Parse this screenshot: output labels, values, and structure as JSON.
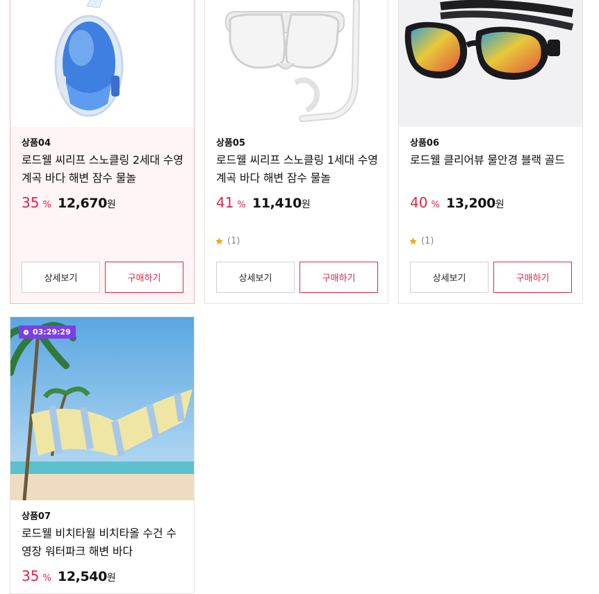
{
  "products": [
    {
      "code": "상품04",
      "name": "로드웰 씨리프 스노클링 2세대 수영 계곡 바다 해변 잠수 물놀",
      "rate": "35",
      "pct": "%",
      "price": "12,670",
      "won": "원",
      "review": "",
      "detail_label": "상세보기",
      "buy_label": "구매하기",
      "image_icon": "full-face-snorkel-mask-icon"
    },
    {
      "code": "상품05",
      "name": "로드웰 씨리프 스노클링 1세대 수영 계곡 바다 해변 잠수 물놀",
      "rate": "41",
      "pct": "%",
      "price": "11,410",
      "won": "원",
      "review": "(1)",
      "detail_label": "상세보기",
      "buy_label": "구매하기",
      "image_icon": "dive-mask-snorkel-icon"
    },
    {
      "code": "상품06",
      "name": "로드웰 클리어뷰 물안경 블랙 골드",
      "rate": "40",
      "pct": "%",
      "price": "13,200",
      "won": "원",
      "review": "(1)",
      "detail_label": "상세보기",
      "buy_label": "구매하기",
      "image_icon": "swim-goggles-icon"
    },
    {
      "code": "상품07",
      "name": "로드웰 비치타월 비치타올 수건 수영장 워터파크 해변 바다",
      "rate": "35",
      "pct": "%",
      "price": "12,540",
      "won": "원",
      "timer": "03:29:29",
      "image_icon": "beach-towel-icon"
    }
  ],
  "colors": {
    "accent": "#e6214c",
    "timer_bg": "#7b3fe4",
    "highlight_border": "#f2b8c0"
  }
}
